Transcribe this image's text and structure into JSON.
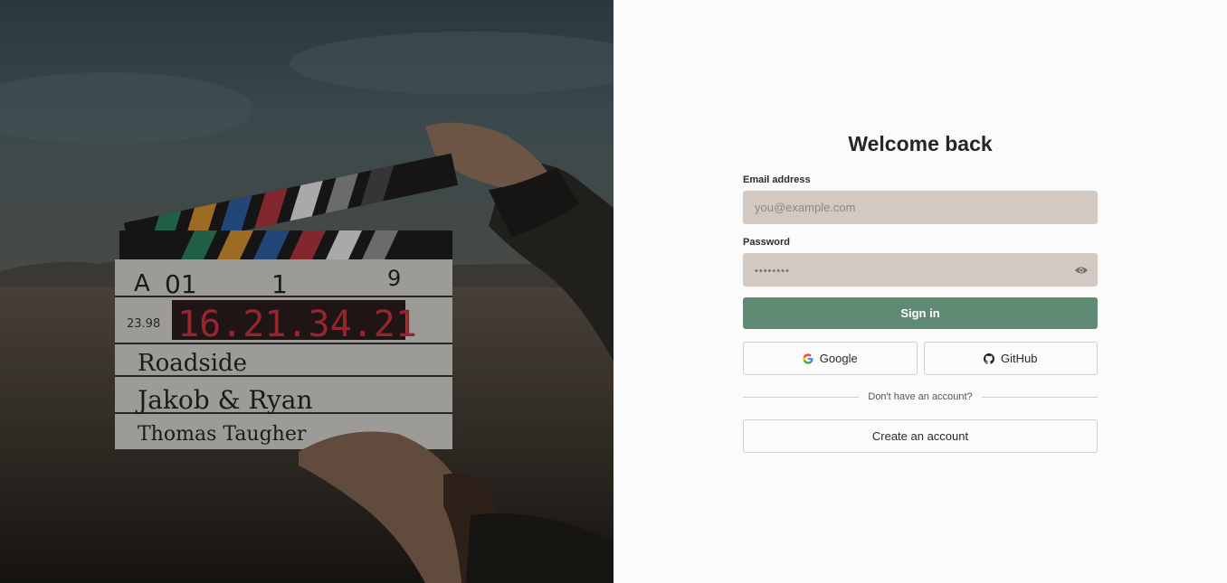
{
  "hero": {
    "image_alt": "Hands holding a film clapperboard in a desert",
    "slate": {
      "roll": "A",
      "scene": "01",
      "take_a": "1",
      "take_b": "9",
      "fps": "23.98",
      "timecode": "16.21.34.21",
      "production": "Roadside",
      "director": "Jakob & Ryan",
      "camera": "Thomas Taugher"
    }
  },
  "login": {
    "title": "Welcome back",
    "email_label": "Email address",
    "email_placeholder": "you@example.com",
    "email_value": "",
    "password_label": "Password",
    "password_placeholder": "••••••••",
    "password_value": "",
    "show_password_icon": "eye-icon",
    "sign_in_label": "Sign in",
    "google_label": "Google",
    "github_label": "GitHub",
    "divider_text": "Don't have an account?",
    "create_account_label": "Create an account"
  },
  "colors": {
    "primary_button": "#5f8b75",
    "input_bg": "#d3c9c3",
    "panel_bg": "#fbfbfb"
  }
}
